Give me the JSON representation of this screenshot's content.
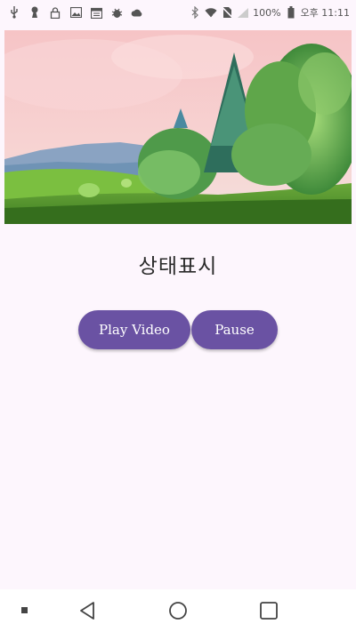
{
  "status_bar": {
    "icons_left": [
      "usb-icon",
      "keyhole-icon",
      "lock-icon",
      "image-icon",
      "calendar-icon",
      "bug-icon",
      "cloud-icon"
    ],
    "icons_right": [
      "bluetooth-icon",
      "wifi-icon",
      "no-sim-icon",
      "signal-icon",
      "battery-icon"
    ],
    "battery_text": "100%",
    "time_text": "오후 11:11"
  },
  "video": {
    "description_icon": "video-frame"
  },
  "main": {
    "status_text": "상태표시"
  },
  "buttons": {
    "play_label": "Play Video",
    "pause_label": "Pause",
    "color": "#6a52a3"
  },
  "nav_bar": {
    "items": [
      "recents-dot-icon",
      "back-icon",
      "home-icon",
      "overview-icon"
    ]
  }
}
